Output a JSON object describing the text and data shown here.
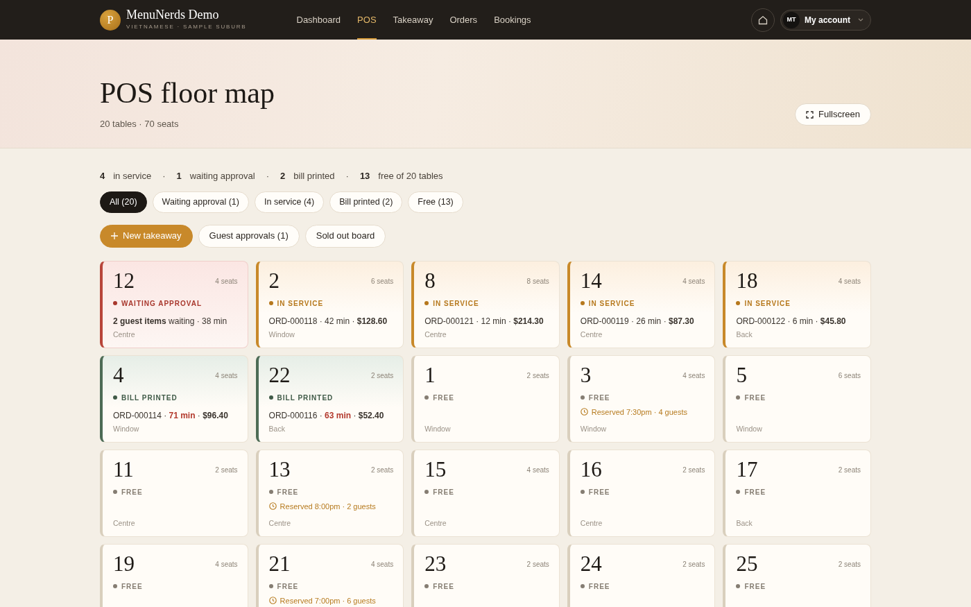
{
  "brand": {
    "logo_letter": "P",
    "name": "MenuNerds Demo",
    "tagline": "VIETNAMESE · SAMPLE SUBURB"
  },
  "nav": [
    {
      "label": "Dashboard",
      "selected": false
    },
    {
      "label": "POS",
      "selected": true
    },
    {
      "label": "Takeaway",
      "selected": false
    },
    {
      "label": "Orders",
      "selected": false
    },
    {
      "label": "Bookings",
      "selected": false
    }
  ],
  "account": {
    "initials": "MT",
    "label": "My account"
  },
  "header": {
    "title": "POS floor map",
    "subtitle": "20 tables · 70 seats",
    "fullscreen_button": "Fullscreen"
  },
  "summary": {
    "separator": "·",
    "items": [
      {
        "count": "4",
        "label": "in service"
      },
      {
        "count": "1",
        "label": "waiting approval"
      },
      {
        "count": "2",
        "label": "bill printed"
      },
      {
        "count": "13",
        "label": "free of 20 tables"
      }
    ]
  },
  "filters": [
    {
      "label": "All (20)",
      "selected": true
    },
    {
      "label": "Waiting approval (1)",
      "selected": false
    },
    {
      "label": "In service (4)",
      "selected": false
    },
    {
      "label": "Bill printed (2)",
      "selected": false
    },
    {
      "label": "Free (13)",
      "selected": false
    }
  ],
  "actions": [
    {
      "kind": "primary",
      "label": "New takeaway"
    },
    {
      "kind": "secondary",
      "label": "Guest approvals (1)"
    },
    {
      "kind": "secondary",
      "label": "Sold out board"
    }
  ],
  "tables": [
    {
      "number": "12",
      "seats": "4 seats",
      "kind": "waiting",
      "status_label": "WAITING APPROVAL",
      "detail": [
        {
          "kind": "bold",
          "text": "2 guest items"
        },
        {
          "kind": "plain",
          "text": " waiting · 38 min"
        }
      ],
      "area": "Centre"
    },
    {
      "number": "2",
      "seats": "6 seats",
      "kind": "service",
      "status_label": "IN SERVICE",
      "detail": [
        {
          "kind": "plain",
          "text": "ORD-000118 · 42 min · "
        },
        {
          "kind": "bold",
          "text": "$128.60"
        }
      ],
      "area": "Window"
    },
    {
      "number": "8",
      "seats": "8 seats",
      "kind": "service",
      "status_label": "IN SERVICE",
      "detail": [
        {
          "kind": "plain",
          "text": "ORD-000121 · 12 min · "
        },
        {
          "kind": "bold",
          "text": "$214.30"
        }
      ],
      "area": "Centre"
    },
    {
      "number": "14",
      "seats": "4 seats",
      "kind": "service",
      "status_label": "IN SERVICE",
      "detail": [
        {
          "kind": "plain",
          "text": "ORD-000119 · 26 min · "
        },
        {
          "kind": "bold",
          "text": "$87.30"
        }
      ],
      "area": "Centre"
    },
    {
      "number": "18",
      "seats": "4 seats",
      "kind": "service",
      "status_label": "IN SERVICE",
      "detail": [
        {
          "kind": "plain",
          "text": "ORD-000122 · 6 min · "
        },
        {
          "kind": "bold",
          "text": "$45.80"
        }
      ],
      "area": "Back"
    },
    {
      "number": "4",
      "seats": "4 seats",
      "kind": "bill",
      "status_label": "BILL PRINTED",
      "detail": [
        {
          "kind": "plain",
          "text": "ORD-000114 · "
        },
        {
          "kind": "alert",
          "text": "71 min"
        },
        {
          "kind": "plain",
          "text": " · "
        },
        {
          "kind": "bold",
          "text": "$96.40"
        }
      ],
      "area": "Window"
    },
    {
      "number": "22",
      "seats": "2 seats",
      "kind": "bill",
      "status_label": "BILL PRINTED",
      "detail": [
        {
          "kind": "plain",
          "text": "ORD-000116 · "
        },
        {
          "kind": "alert",
          "text": "63 min"
        },
        {
          "kind": "plain",
          "text": " · "
        },
        {
          "kind": "bold",
          "text": "$52.40"
        }
      ],
      "area": "Back"
    },
    {
      "number": "1",
      "seats": "2 seats",
      "kind": "free",
      "status_label": "FREE",
      "area": "Window"
    },
    {
      "number": "3",
      "seats": "4 seats",
      "kind": "free",
      "status_label": "FREE",
      "reservation": "Reserved 7:30pm · 4 guests",
      "area": "Window"
    },
    {
      "number": "5",
      "seats": "6 seats",
      "kind": "free",
      "status_label": "FREE",
      "area": "Window"
    },
    {
      "number": "11",
      "seats": "2 seats",
      "kind": "free",
      "status_label": "FREE",
      "area": "Centre"
    },
    {
      "number": "13",
      "seats": "2 seats",
      "kind": "free",
      "status_label": "FREE",
      "reservation": "Reserved 8:00pm · 2 guests",
      "area": "Centre"
    },
    {
      "number": "15",
      "seats": "4 seats",
      "kind": "free",
      "status_label": "FREE",
      "area": "Centre"
    },
    {
      "number": "16",
      "seats": "2 seats",
      "kind": "free",
      "status_label": "FREE",
      "area": "Centre"
    },
    {
      "number": "17",
      "seats": "2 seats",
      "kind": "free",
      "status_label": "FREE",
      "area": "Back"
    },
    {
      "number": "19",
      "seats": "4 seats",
      "kind": "free",
      "status_label": "FREE"
    },
    {
      "number": "21",
      "seats": "4 seats",
      "kind": "free",
      "status_label": "FREE",
      "reservation": "Reserved 7:00pm · 6 guests"
    },
    {
      "number": "23",
      "seats": "2 seats",
      "kind": "free",
      "status_label": "FREE"
    },
    {
      "number": "24",
      "seats": "2 seats",
      "kind": "free",
      "status_label": "FREE"
    },
    {
      "number": "25",
      "seats": "2 seats",
      "kind": "free",
      "status_label": "FREE"
    }
  ]
}
